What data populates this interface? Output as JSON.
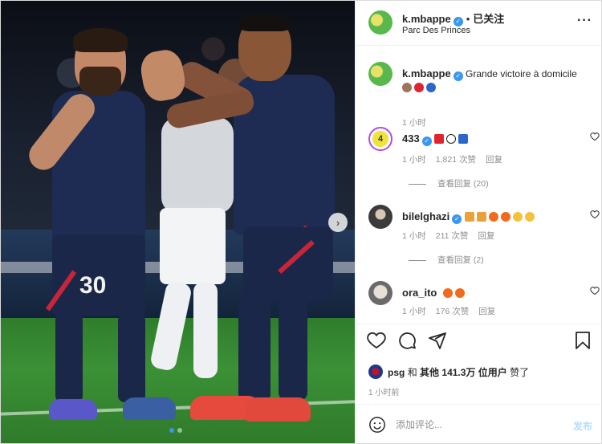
{
  "post": {
    "username": "k.mbappe",
    "follow_status": "已关注",
    "location": "Parc Des Princes",
    "shirt_number": "30"
  },
  "caption": {
    "username": "k.mbappe",
    "text": "Grande victoire à domicile",
    "emojis": [
      "fist-emoji",
      "red-circle-emoji",
      "blue-circle-emoji"
    ],
    "time": "1 小时"
  },
  "comments": [
    {
      "username": "433",
      "avatar_label": "4",
      "text": "",
      "emojis": [
        "red-heart-emoji",
        "soccer-ball-emoji",
        "blue-heart-emoji"
      ],
      "time": "1 小时",
      "likes": "1,821 次赞",
      "reply": "回复",
      "view_replies": "查看回复 (20)"
    },
    {
      "username": "bilelghazi",
      "text": "",
      "emojis": [
        "gift-emoji",
        "gift-emoji",
        "fire-emoji",
        "fire-emoji",
        "clap-emoji",
        "clap-emoji"
      ],
      "time": "1 小时",
      "likes": "211 次赞",
      "reply": "回复",
      "view_replies": "查看回复 (2)"
    },
    {
      "username": "ora_ito",
      "text": "",
      "emojis": [
        "fire-emoji",
        "fire-emoji"
      ],
      "time": "1 小时",
      "likes": "176 次赞",
      "reply": "回复"
    }
  ],
  "likes": {
    "user": "psg",
    "and": "和",
    "others": "其他",
    "count": "141.3万",
    "suffix": "位用户",
    "verb": "赞了"
  },
  "posted_ago": "1 小时前",
  "add_comment": {
    "placeholder": "添加评论...",
    "post_label": "发布"
  },
  "colors": {
    "verified_blue": "#3897f0",
    "heart_red": "#ed4956",
    "psg_navy": "#1e2b52"
  }
}
